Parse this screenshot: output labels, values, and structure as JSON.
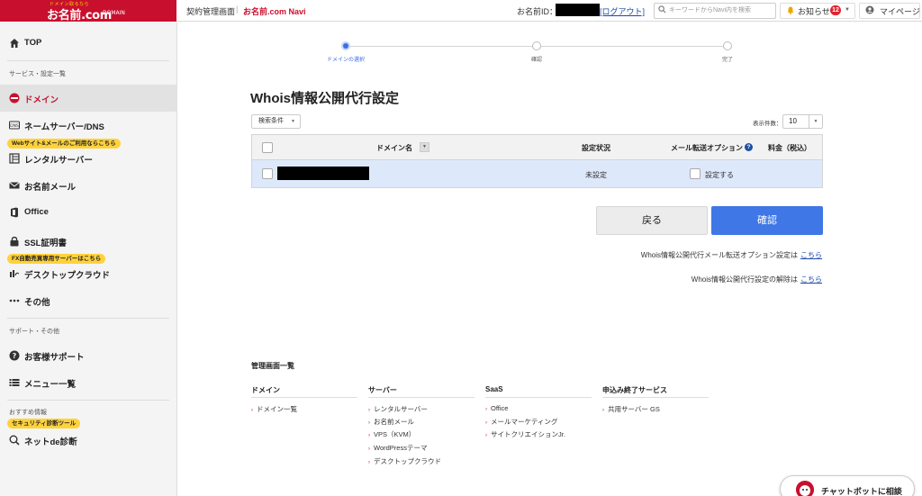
{
  "header": {
    "logo_tag": "ドメイン取るなら",
    "logo_main": "お名前.com",
    "logo_domain": "DOMAIN",
    "contract_label": "契約管理画面",
    "separator": "|",
    "navi_label": "お名前.com Navi",
    "id_label": "お名前ID：",
    "logout_label": "[ログアウト]",
    "search_placeholder": "キーワードからNavi内を検索",
    "notice_label": "お知らせ",
    "notice_count": "12",
    "mypage_label": "マイページ",
    "colors": {
      "brand": "#c8102e",
      "badge": "#e5202e"
    }
  },
  "sidebar": {
    "top": "TOP",
    "section_service": "サービス・設定一覧",
    "domain": "ドメイン",
    "ns_dns": "ネームサーバー/DNS",
    "tag_web": "Webサイト&メールのご利用ならこちら",
    "rental_server": "レンタルサーバー",
    "mail": "お名前メール",
    "office": "Office",
    "ssl": "SSL証明書",
    "tag_fx": "FX自動売買専用サーバーはこちら",
    "desktop_cloud": "デスクトップクラウド",
    "other": "その他",
    "section_support": "サポート・その他",
    "support": "お客様サポート",
    "menu_list": "メニュー一覧",
    "section_recommend": "おすすめ情報",
    "tag_security": "セキュリティ診断ツール",
    "net_diag": "ネットde診断"
  },
  "stepper": {
    "steps": [
      "ドメインの選択",
      "確認",
      "完了"
    ],
    "active_index": 0,
    "accent": "#3a6ee8"
  },
  "main": {
    "title": "Whois情報公開代行設定",
    "filter_label": "検索条件",
    "per_page_label": "表示件数：",
    "per_page_value": "10",
    "table": {
      "headers": [
        "ドメイン名",
        "設定状況",
        "メール転送オプション",
        "料金（税込）"
      ],
      "rows": [
        {
          "status": "未設定",
          "mail_option": "設定する"
        }
      ]
    },
    "back_button": "戻る",
    "confirm_button": "確認",
    "note1": "Whois情報公開代行メール転送オプション設定は",
    "note2": "Whois情報公開代行設定の解除は",
    "link": "こちら"
  },
  "footer_nav": {
    "heading": "管理画面一覧",
    "columns": [
      {
        "title": "ドメイン",
        "links": [
          "ドメイン一覧"
        ]
      },
      {
        "title": "サーバー",
        "links": [
          "レンタルサーバー",
          "お名前メール",
          "VPS（KVM）",
          "WordPressテーマ",
          "デスクトップクラウド"
        ]
      },
      {
        "title": "SaaS",
        "links": [
          "Office",
          "メールマーケティング",
          "サイトクリエイションJr."
        ]
      },
      {
        "title": "申込み終了サービス",
        "links": [
          "共用サーバー GS"
        ]
      }
    ]
  },
  "chatbot": {
    "label": "チャットボットに相談"
  }
}
